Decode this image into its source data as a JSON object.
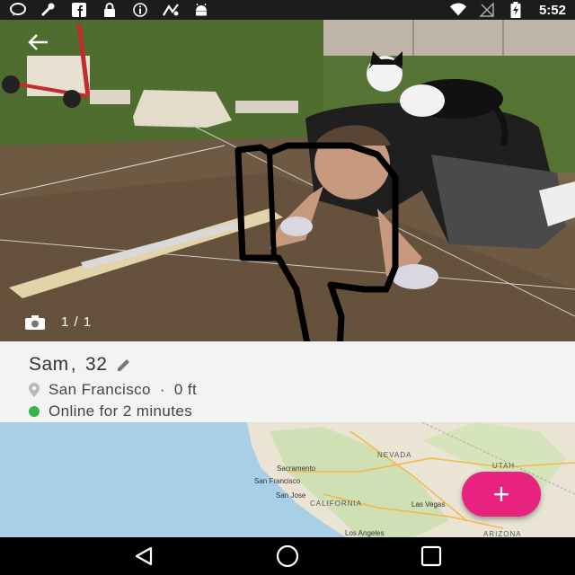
{
  "status_bar": {
    "icons_left": [
      "chat-bubble-icon",
      "wrench-icon",
      "facebook-icon",
      "lock-icon",
      "info-icon",
      "app-icon",
      "android-icon"
    ],
    "icons_right": [
      "wifi-icon",
      "signal-off-icon",
      "battery-charging-icon"
    ],
    "time": "5:52"
  },
  "photo": {
    "counter": "1 / 1"
  },
  "profile": {
    "name": "Sam",
    "age": "32",
    "separator": ",",
    "location": "San Francisco",
    "distance": "0 ft",
    "location_sep": "·",
    "status": "Online for 2 minutes",
    "status_color": "#37b24d"
  },
  "map": {
    "states": [
      "NEVADA",
      "UTAH",
      "CALIFORNIA",
      "ARIZONA"
    ],
    "cities": [
      "Sacramento",
      "San Francisco",
      "San Jose",
      "Las Vegas",
      "Los Angeles"
    ]
  },
  "fab": {
    "label": "+",
    "color": "#e8227f"
  }
}
